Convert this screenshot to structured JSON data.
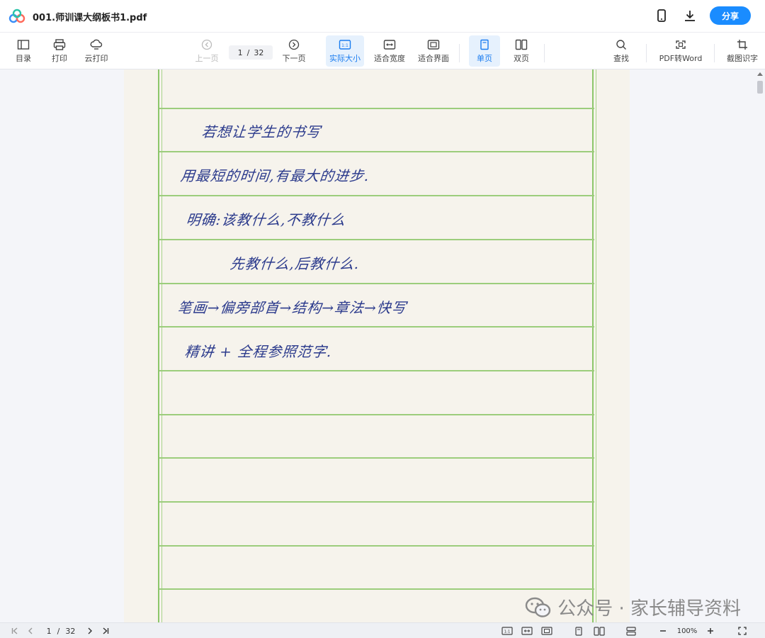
{
  "titlebar": {
    "title": "001.师训课大纲板书1.pdf",
    "share_label": "分享"
  },
  "toolbar": {
    "toc": "目录",
    "print": "打印",
    "cloud_print": "云打印",
    "prev_page": "上一页",
    "page_current": "1",
    "page_sep": "/",
    "page_total": "32",
    "next_page": "下一页",
    "actual_size": "实际大小",
    "fit_width": "适合宽度",
    "fit_page": "适合界面",
    "single_page": "单页",
    "double_page": "双页",
    "find": "查找",
    "pdf_to_word": "PDF转Word",
    "screenshot_ocr": "截图识字"
  },
  "document": {
    "lines": [
      "若想让学生的书写",
      "用最短的时间,有最大的进步.",
      "明确:该教什么,不教什么",
      "先教什么,后教什么.",
      "笔画→偏旁部首→结构→章法→快写",
      "精讲 + 全程参照范字."
    ]
  },
  "watermark": {
    "text": "公众号 · 家长辅导资料"
  },
  "bottombar": {
    "page_current": "1",
    "page_sep": "/",
    "page_total": "32",
    "zoom": "100%"
  },
  "colors": {
    "accent": "#1a8cff",
    "ink": "#2b3a8c",
    "rule_green": "#9ccd7c"
  }
}
